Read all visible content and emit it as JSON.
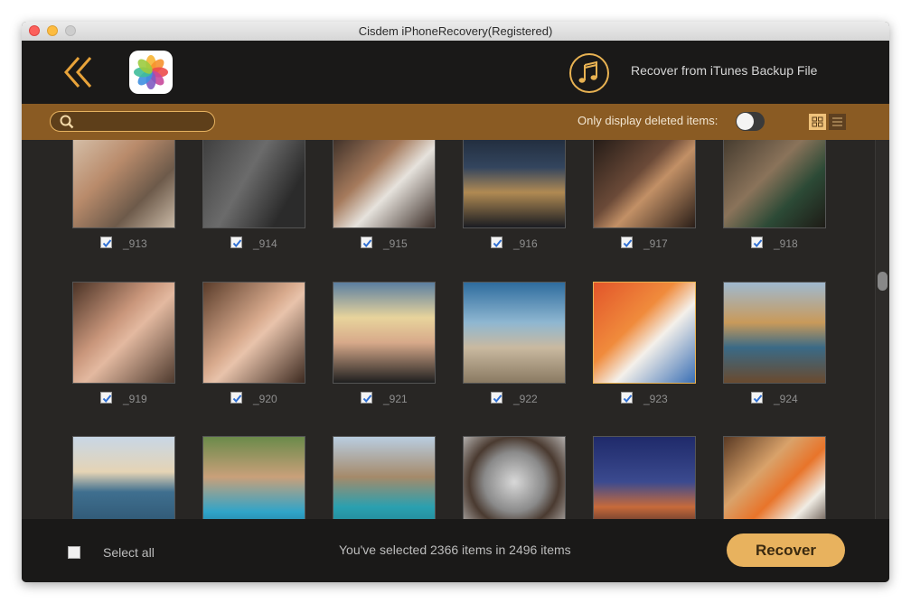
{
  "window": {
    "title": "Cisdem iPhoneRecovery(Registered)"
  },
  "header": {
    "back_icon": "double-chevron-left-icon",
    "category_icon": "photos-app-icon",
    "itunes_icon": "music-note-icon",
    "itunes_label": "Recover from iTunes Backup File"
  },
  "toolbar": {
    "search_value": "",
    "search_placeholder": "",
    "deleted_label": "Only display deleted items:",
    "deleted_toggle_on": false,
    "view_modes": [
      "grid-view-icon",
      "list-view-icon"
    ],
    "active_view": "grid"
  },
  "items": [
    {
      "label": "_913",
      "checked": true
    },
    {
      "label": "_914",
      "checked": true
    },
    {
      "label": "_915",
      "checked": true
    },
    {
      "label": "_916",
      "checked": true
    },
    {
      "label": "_917",
      "checked": true
    },
    {
      "label": "_918",
      "checked": true
    },
    {
      "label": "_919",
      "checked": true
    },
    {
      "label": "_920",
      "checked": true
    },
    {
      "label": "_921",
      "checked": true
    },
    {
      "label": "_922",
      "checked": true
    },
    {
      "label": "_923",
      "checked": true
    },
    {
      "label": "_924",
      "checked": true
    },
    {
      "label": "",
      "checked": false
    },
    {
      "label": "",
      "checked": false
    },
    {
      "label": "",
      "checked": false
    },
    {
      "label": "",
      "checked": false
    },
    {
      "label": "",
      "checked": false
    },
    {
      "label": "",
      "checked": false
    }
  ],
  "footer": {
    "select_all_label": "Select all",
    "select_all_checked": false,
    "summary": "You've selected 2366 items in 2496 items",
    "recover_label": "Recover"
  },
  "colors": {
    "accent": "#e8b25e",
    "toolbar": "#8a5b23",
    "background": "#282624",
    "header": "#1a1918"
  }
}
